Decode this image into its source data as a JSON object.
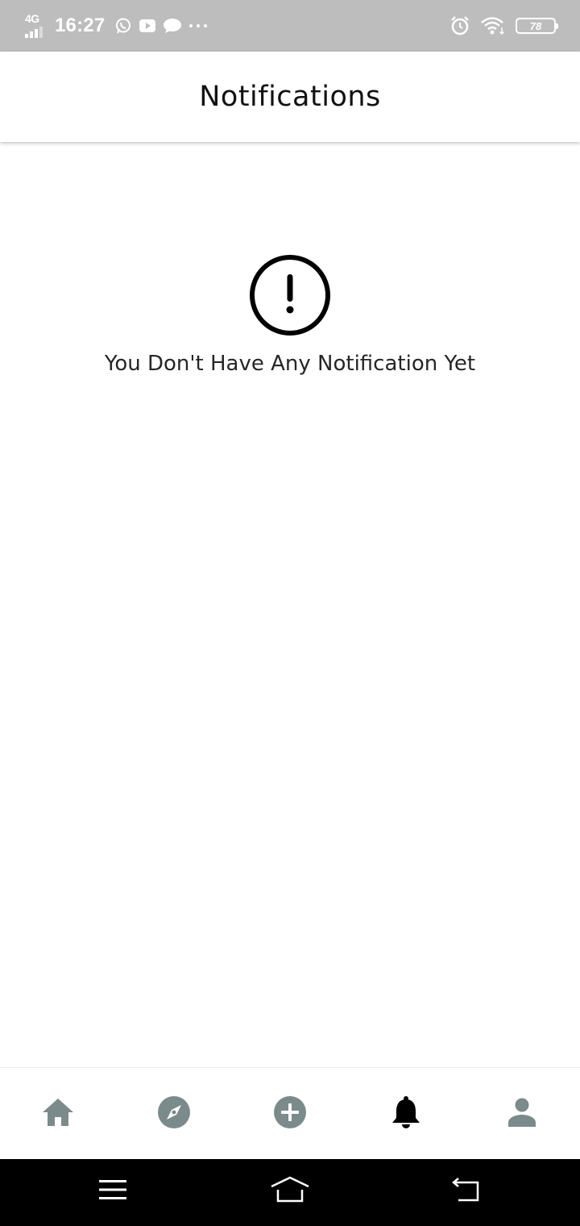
{
  "status_bar": {
    "network": "4G",
    "time": "16:27",
    "notification_icons": [
      "whatsapp-icon",
      "youtube-icon",
      "message-icon",
      "more-dots-icon"
    ],
    "right_icons": [
      "alarm-icon",
      "wifi-icon",
      "battery-icon"
    ],
    "battery": "78"
  },
  "header": {
    "title": "Notifications"
  },
  "empty_state": {
    "icon": "exclamation-circle-icon",
    "message": "You Don't Have Any Notification Yet"
  },
  "bottom_nav": {
    "items": [
      {
        "icon": "home-icon",
        "active": false
      },
      {
        "icon": "compass-icon",
        "active": false
      },
      {
        "icon": "add-circle-icon",
        "active": false
      },
      {
        "icon": "bell-icon",
        "active": true
      },
      {
        "icon": "person-icon",
        "active": false
      }
    ]
  },
  "system_nav": {
    "buttons": [
      "menu-icon",
      "home-outline-icon",
      "back-icon"
    ]
  },
  "colors": {
    "status_bar": "#bdbdbd",
    "nav_inactive": "#7b8b8b",
    "nav_active": "#000000",
    "text": "#262626",
    "system_nav": "#000000"
  }
}
